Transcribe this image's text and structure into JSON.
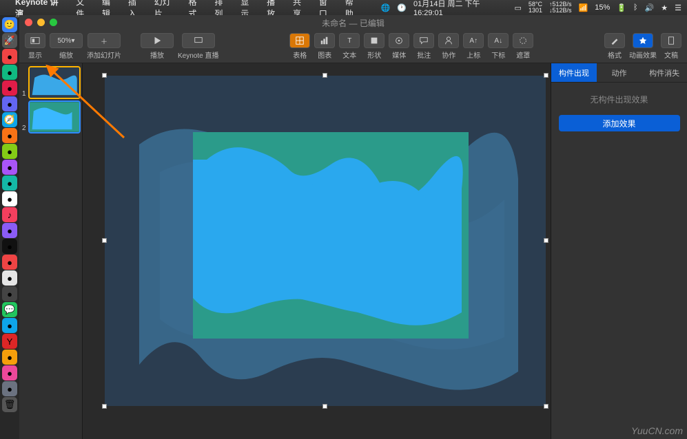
{
  "menubar": {
    "apple": "",
    "app_name": "Keynote 讲演",
    "items": [
      "文件",
      "编辑",
      "插入",
      "幻灯片",
      "格式",
      "排列",
      "显示",
      "播放",
      "共享",
      "窗口",
      "帮助"
    ],
    "status": {
      "date": "01月14日 周二 下午16:29:01",
      "temp_top": "58°C",
      "temp_bot": "1301",
      "net_up": "↑512B/s",
      "net_down": "↓512B/s",
      "battery_pct": "15%"
    }
  },
  "window": {
    "title": "未命名 — 已编辑"
  },
  "toolbar": {
    "view": "显示",
    "zoom_value": "50%",
    "zoom_label": "缩放",
    "add_slide": "添加幻灯片",
    "play": "播放",
    "live": "Keynote 直播",
    "table": "表格",
    "chart": "图表",
    "text": "文本",
    "shape": "形状",
    "media": "媒体",
    "comment": "批注",
    "collab": "协作",
    "super": "上标",
    "sub": "下标",
    "mask": "遮罩",
    "format": "格式",
    "animate": "动画效果",
    "document": "文稿"
  },
  "navigator": {
    "slides": [
      {
        "num": "1"
      },
      {
        "num": "2"
      }
    ]
  },
  "inspector": {
    "tabs": {
      "build_in": "构件出现",
      "action": "动作",
      "build_out": "构件消失"
    },
    "empty_msg": "无构件出现效果",
    "add_btn": "添加效果"
  },
  "watermark": "YuuCN.com",
  "dock_icons": [
    "finder",
    "launchpad",
    "safari",
    "mail",
    "maps",
    "photos",
    "messages",
    "facetime",
    "calendar",
    "contacts",
    "reminders",
    "notes",
    "music",
    "podcasts",
    "tv",
    "appstore",
    "settings",
    "terminal",
    "vscode",
    "chrome",
    "wechat",
    "qq",
    "yandex",
    "trash"
  ]
}
